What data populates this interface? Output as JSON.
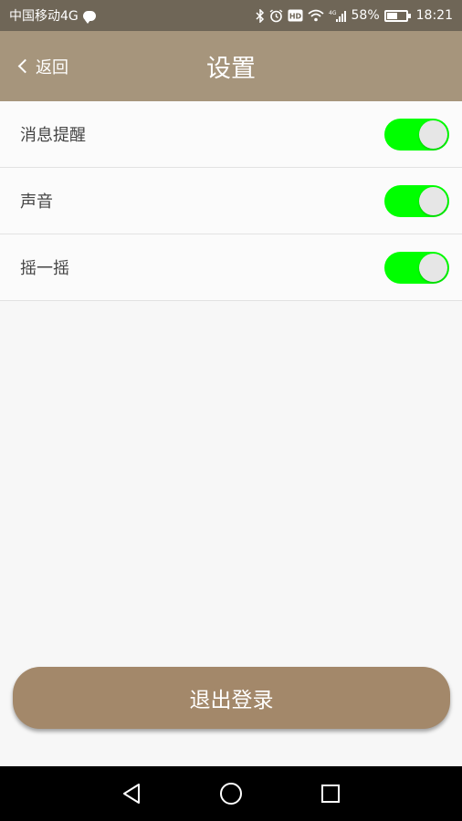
{
  "statusbar": {
    "carrier": "中国移动4G",
    "hd": "HD",
    "network": "4G",
    "battery": "58%",
    "battery_level": 0.58,
    "time": "18:21",
    "icons": [
      "chat-bubble-icon",
      "bluetooth-icon",
      "alarm-icon",
      "hd-icon",
      "wifi-icon",
      "signal-icon",
      "battery-icon"
    ]
  },
  "header": {
    "back_label": "返回",
    "title": "设置"
  },
  "settings": [
    {
      "label": "消息提醒",
      "enabled": true
    },
    {
      "label": "声音",
      "enabled": true
    },
    {
      "label": "摇一摇",
      "enabled": true
    }
  ],
  "logout_label": "退出登录",
  "colors": {
    "statusbar": "#6f6657",
    "header": "#a6957c",
    "toggle_on": "#00ff00",
    "logout": "#a3886a"
  },
  "navbar": {
    "icons": [
      "back-triangle-icon",
      "home-circle-icon",
      "recents-square-icon"
    ]
  }
}
